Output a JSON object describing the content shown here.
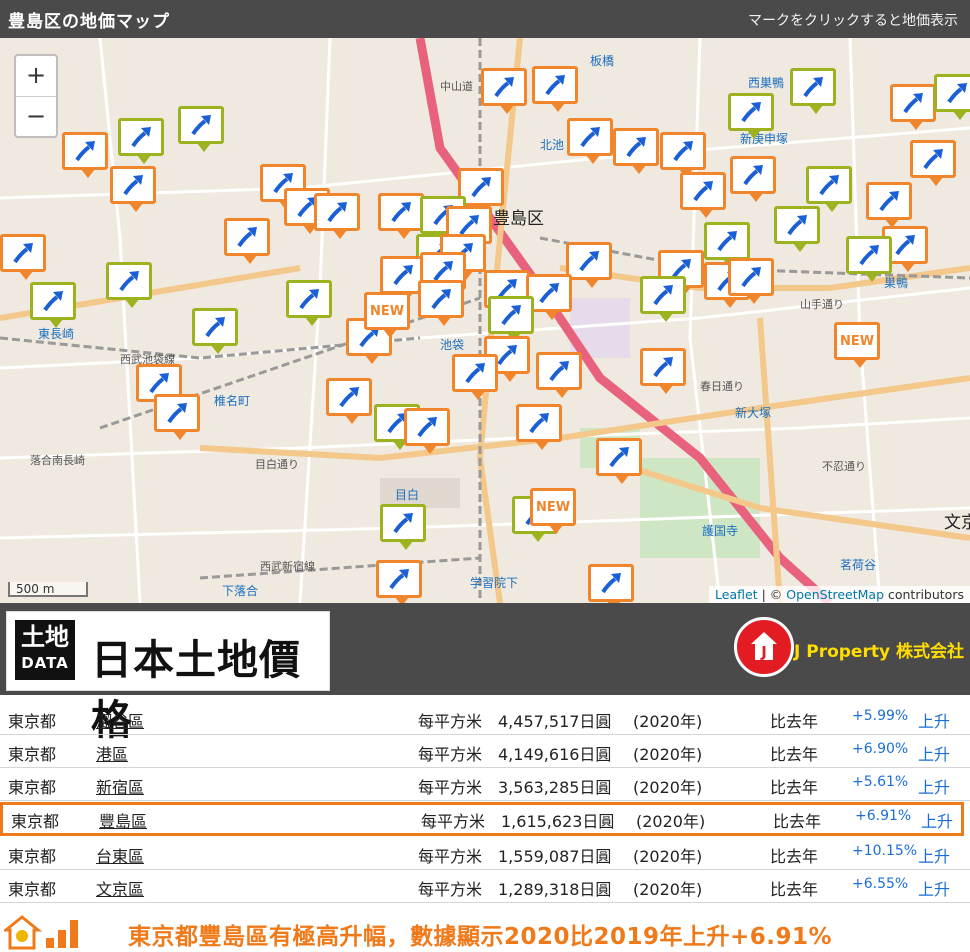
{
  "header": {
    "title": "豊島区の地価マップ",
    "hint": "マークをクリックすると地価表示"
  },
  "map": {
    "zoom_in": "+",
    "zoom_out": "−",
    "scale": "500 m",
    "attribution": {
      "leaflet": "Leaflet",
      "sep": " | © ",
      "osm": "OpenStreetMap",
      "tail": " contributors"
    },
    "new_label": "NEW",
    "labels": {
      "ward": "豊島区",
      "higashinagasaki": "東長崎",
      "shiinamachi": "椎名町",
      "ikebukuro": "池袋",
      "mejiro": "目白",
      "otsuka": "新大塚",
      "sugamo": "巣鴨",
      "ochiai": "落合南長崎",
      "gokokuji": "護国寺",
      "myogadani": "茗荷谷",
      "shimoochiai": "下落合",
      "gakushuin": "学習院下",
      "komagome": "北池",
      "nishisugamo": "西巣鴨",
      "shinkoshinzuka": "新庚申塚",
      "bunkyo": "文京",
      "itabashi": "板橋",
      "mejiro_dori": "目白通り",
      "yamate": "山手通り",
      "seibu": "西武池袋線",
      "shinjukusen": "西武新宿線",
      "kasuga": "春日通り",
      "shinobazu": "不忍通り",
      "nakasendo": "中山道"
    }
  },
  "brand": {
    "logo_tile_kanji": "土地",
    "logo_tile_data": "DATA",
    "logo_name": "日本土地價格",
    "company": "J Property 株式会社",
    "company_mark": "J"
  },
  "table": {
    "rows": [
      {
        "pref": "東京都",
        "ward": "澀谷區",
        "unit": "每平方米",
        "price": "4,457,517日圓",
        "year": "(2020年)",
        "cmp": "比去年",
        "pct": "+5.99%",
        "trend": "上升"
      },
      {
        "pref": "東京都",
        "ward": "港區",
        "unit": "每平方米",
        "price": "4,149,616日圓",
        "year": "(2020年)",
        "cmp": "比去年",
        "pct": "+6.90%",
        "trend": "上升"
      },
      {
        "pref": "東京都",
        "ward": "新宿區",
        "unit": "每平方米",
        "price": "3,563,285日圓",
        "year": "(2020年)",
        "cmp": "比去年",
        "pct": "+5.61%",
        "trend": "上升"
      },
      {
        "pref": "東京都",
        "ward": "豐島區",
        "unit": "每平方米",
        "price": "1,615,623日圓",
        "year": "(2020年)",
        "cmp": "比去年",
        "pct": "+6.91%",
        "trend": "上升"
      },
      {
        "pref": "東京都",
        "ward": "台東區",
        "unit": "每平方米",
        "price": "1,559,087日圓",
        "year": "(2020年)",
        "cmp": "比去年",
        "pct": "+10.15%",
        "trend": "上升"
      },
      {
        "pref": "東京都",
        "ward": "文京區",
        "unit": "每平方米",
        "price": "1,289,318日圓",
        "year": "(2020年)",
        "cmp": "比去年",
        "pct": "+6.55%",
        "trend": "上升"
      }
    ]
  },
  "footer": {
    "message": "東京都豐島區有極高升幅，數據顯示2020比2019年上升+6.91%"
  },
  "colors": {
    "orange": "#f0852b",
    "green": "#9cb21f",
    "arrow": "#1b5fd6",
    "highlight": "#f07a1a",
    "red": "#e31b23"
  }
}
